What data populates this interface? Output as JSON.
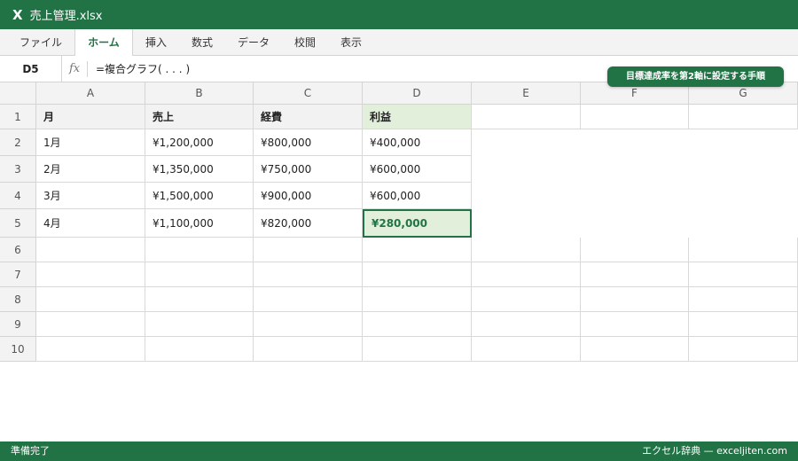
{
  "window": {
    "app_icon_text": "X",
    "title": "売上管理.xlsx"
  },
  "ribbon": {
    "tabs": [
      {
        "label": "ファイル",
        "active": false
      },
      {
        "label": "ホーム",
        "active": true
      },
      {
        "label": "挿入",
        "active": false
      },
      {
        "label": "数式",
        "active": false
      },
      {
        "label": "データ",
        "active": false
      },
      {
        "label": "校閲",
        "active": false
      },
      {
        "label": "表示",
        "active": false
      }
    ]
  },
  "formula_bar": {
    "name_box": "D5",
    "fx_label": "fx",
    "formula": "=複合グラフ( . . . )"
  },
  "badge": {
    "text": "目標達成率を第2軸に設定する手順"
  },
  "sheet": {
    "columns": [
      "A",
      "B",
      "C",
      "D",
      "E",
      "F",
      "G"
    ],
    "rows": [
      "1",
      "2",
      "3",
      "4",
      "5",
      "6",
      "7",
      "8",
      "9",
      "10"
    ],
    "header_row": [
      "月",
      "売上",
      "経費",
      "利益"
    ],
    "data": [
      [
        "1月",
        "¥1,200,000",
        "¥800,000",
        "¥400,000"
      ],
      [
        "2月",
        "¥1,350,000",
        "¥750,000",
        "¥600,000"
      ],
      [
        "3月",
        "¥1,500,000",
        "¥900,000",
        "¥600,000"
      ],
      [
        "4月",
        "¥1,100,000",
        "¥820,000",
        "¥280,000"
      ]
    ],
    "selected_cell": "D5"
  },
  "status": {
    "left": "準備完了",
    "right": "エクセル辞典 — exceljiten.com"
  },
  "colors": {
    "accent": "#217346",
    "highlight": "#e2efda"
  }
}
